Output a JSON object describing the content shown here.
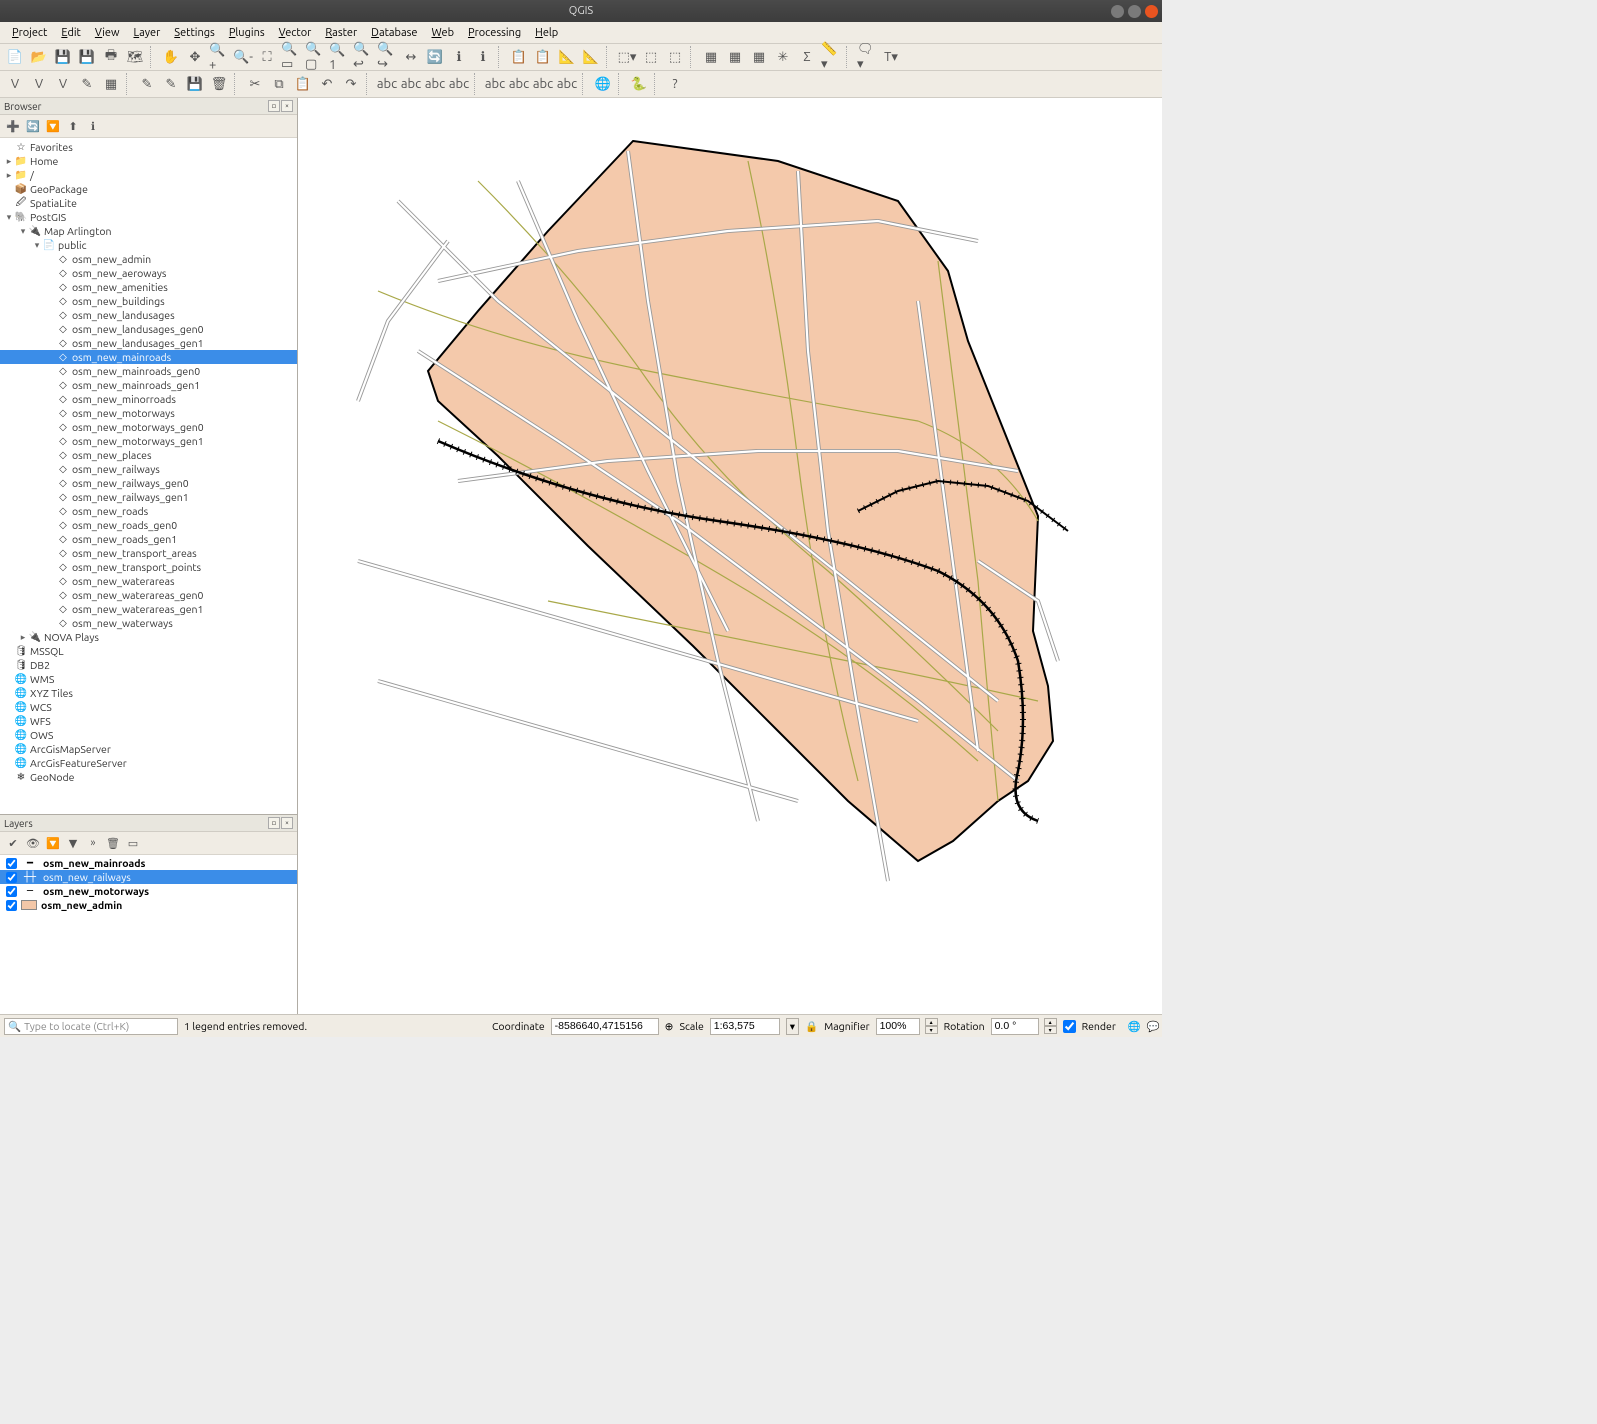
{
  "window": {
    "title": "QGIS"
  },
  "menubar": [
    "Project",
    "Edit",
    "View",
    "Layer",
    "Settings",
    "Plugins",
    "Vector",
    "Raster",
    "Database",
    "Web",
    "Processing",
    "Help"
  ],
  "toolbar_icons_row1": [
    "📄",
    "📂",
    "💾",
    "💾",
    "🖶",
    "🗺",
    "",
    "✋",
    "✥",
    "🔍+",
    "🔍-",
    "⛶",
    "🔍▭",
    "🔍▢",
    "🔍1",
    "🔍↩",
    "🔍↪",
    "↔",
    "🔄",
    "ℹ",
    "ℹ",
    "",
    "📋",
    "📋",
    "📐",
    "📐",
    "",
    "⬚▾",
    "⬚",
    "⬚",
    "",
    "▦",
    "▦",
    "▦",
    "✳",
    "Σ",
    "📏▾",
    "",
    "🗨▾",
    "T▾"
  ],
  "toolbar_icons_row2": [
    "V",
    "V",
    "V",
    "✎",
    "▦",
    "",
    "✎",
    "✎",
    "💾",
    "🗑",
    "",
    "✂",
    "⧉",
    "📋",
    "↶",
    "↷",
    "",
    "abc",
    "abc",
    "abc",
    "abc",
    "",
    "abc",
    "abc",
    "abc",
    "abc",
    "",
    "🌐",
    "",
    "🐍",
    "",
    "?"
  ],
  "browser": {
    "title": "Browser",
    "toolbar": [
      "➕",
      "🔄",
      "🔽",
      "⬆",
      "ℹ"
    ],
    "top_items": [
      {
        "icon": "☆",
        "label": "Favorites",
        "exp": ""
      },
      {
        "icon": "📁",
        "label": "Home",
        "exp": "▸"
      },
      {
        "icon": "📁",
        "label": "/",
        "exp": "▸"
      },
      {
        "icon": "📦",
        "label": "GeoPackage",
        "exp": ""
      },
      {
        "icon": "🖉",
        "label": "SpatiaLite",
        "exp": ""
      }
    ],
    "postgis": {
      "label": "PostGIS",
      "connection": "Map Arlington",
      "schema": "public",
      "tables": [
        "osm_new_admin",
        "osm_new_aeroways",
        "osm_new_amenities",
        "osm_new_buildings",
        "osm_new_landusages",
        "osm_new_landusages_gen0",
        "osm_new_landusages_gen1",
        "osm_new_mainroads",
        "osm_new_mainroads_gen0",
        "osm_new_mainroads_gen1",
        "osm_new_minorroads",
        "osm_new_motorways",
        "osm_new_motorways_gen0",
        "osm_new_motorways_gen1",
        "osm_new_places",
        "osm_new_railways",
        "osm_new_railways_gen0",
        "osm_new_railways_gen1",
        "osm_new_roads",
        "osm_new_roads_gen0",
        "osm_new_roads_gen1",
        "osm_new_transport_areas",
        "osm_new_transport_points",
        "osm_new_waterareas",
        "osm_new_waterareas_gen0",
        "osm_new_waterareas_gen1",
        "osm_new_waterways"
      ],
      "selected": "osm_new_mainroads",
      "nova_plays": "NOVA Plays"
    },
    "bottom_items": [
      {
        "icon": "🛢",
        "label": "MSSQL"
      },
      {
        "icon": "🛢",
        "label": "DB2"
      },
      {
        "icon": "🌐",
        "label": "WMS"
      },
      {
        "icon": "🌐",
        "label": "XYZ Tiles"
      },
      {
        "icon": "🌐",
        "label": "WCS"
      },
      {
        "icon": "🌐",
        "label": "WFS"
      },
      {
        "icon": "🌐",
        "label": "OWS"
      },
      {
        "icon": "🌐",
        "label": "ArcGisMapServer"
      },
      {
        "icon": "🌐",
        "label": "ArcGisFeatureServer"
      },
      {
        "icon": "❄",
        "label": "GeoNode"
      }
    ]
  },
  "layers": {
    "title": "Layers",
    "toolbar": [
      "✔",
      "👁",
      "🔽",
      "▼",
      "»",
      "🗑",
      "▭"
    ],
    "items": [
      {
        "name": "osm_new_mainroads",
        "checked": true,
        "selected": false,
        "sym": "line-dark",
        "bold": true
      },
      {
        "name": "osm_new_railways",
        "checked": true,
        "selected": true,
        "sym": "rail",
        "bold": false
      },
      {
        "name": "osm_new_motorways",
        "checked": true,
        "selected": false,
        "sym": "line",
        "bold": true
      },
      {
        "name": "osm_new_admin",
        "checked": true,
        "selected": false,
        "sym": "swatch",
        "swatch": "#f3c7a8",
        "bold": true
      }
    ]
  },
  "statusbar": {
    "locator_placeholder": "Type to locate (Ctrl+K)",
    "message": "1 legend entries removed.",
    "coord_label": "Coordinate",
    "coord_value": "-8586640,4715156",
    "scale_label": "Scale",
    "scale_value": "1:63,575",
    "magnifier_label": "Magnifier",
    "magnifier_value": "100%",
    "rotation_label": "Rotation",
    "rotation_value": "0.0 °",
    "render_label": "Render"
  }
}
